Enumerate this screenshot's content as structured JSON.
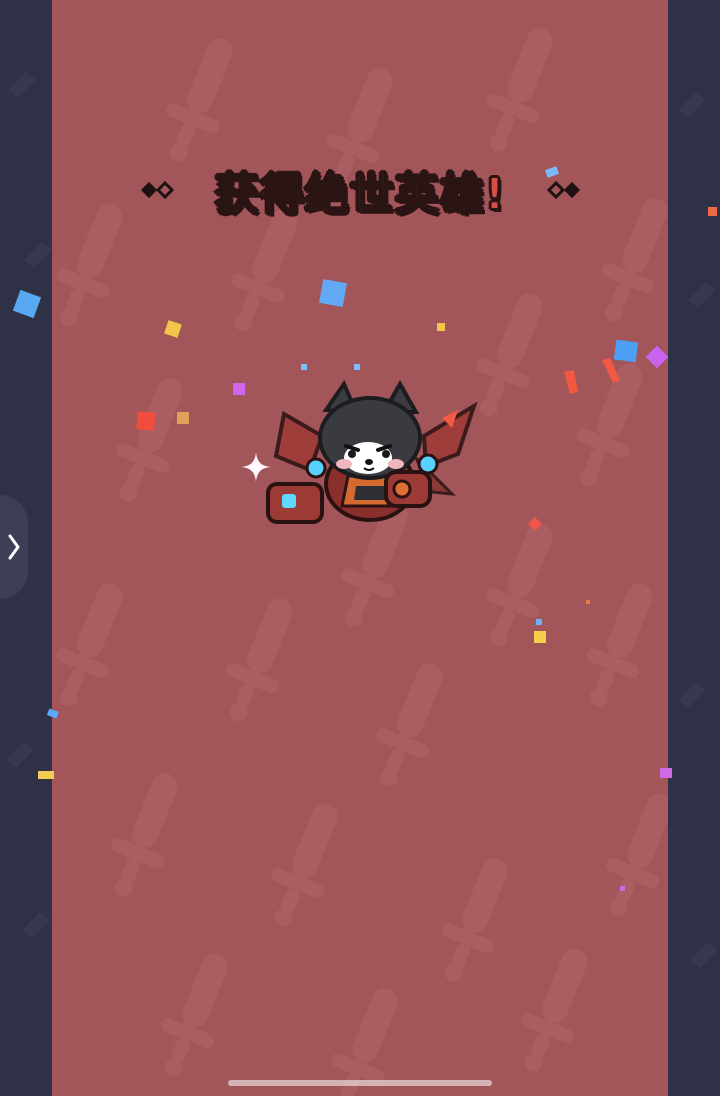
{
  "title": "获得绝世英雄!",
  "colors": {
    "panel": "#a25659",
    "side": "#2f3146",
    "title_fill": "#d84f48",
    "title_outline": "#2b1414"
  },
  "icons": {
    "left_decoration": "double-diamond-icon",
    "right_decoration": "double-diamond-icon",
    "hero": "armored-wolf-hero-icon",
    "sparkle": "sparkle-icon",
    "edge_tab": "chevron-right-icon",
    "background": "sword-pattern"
  }
}
